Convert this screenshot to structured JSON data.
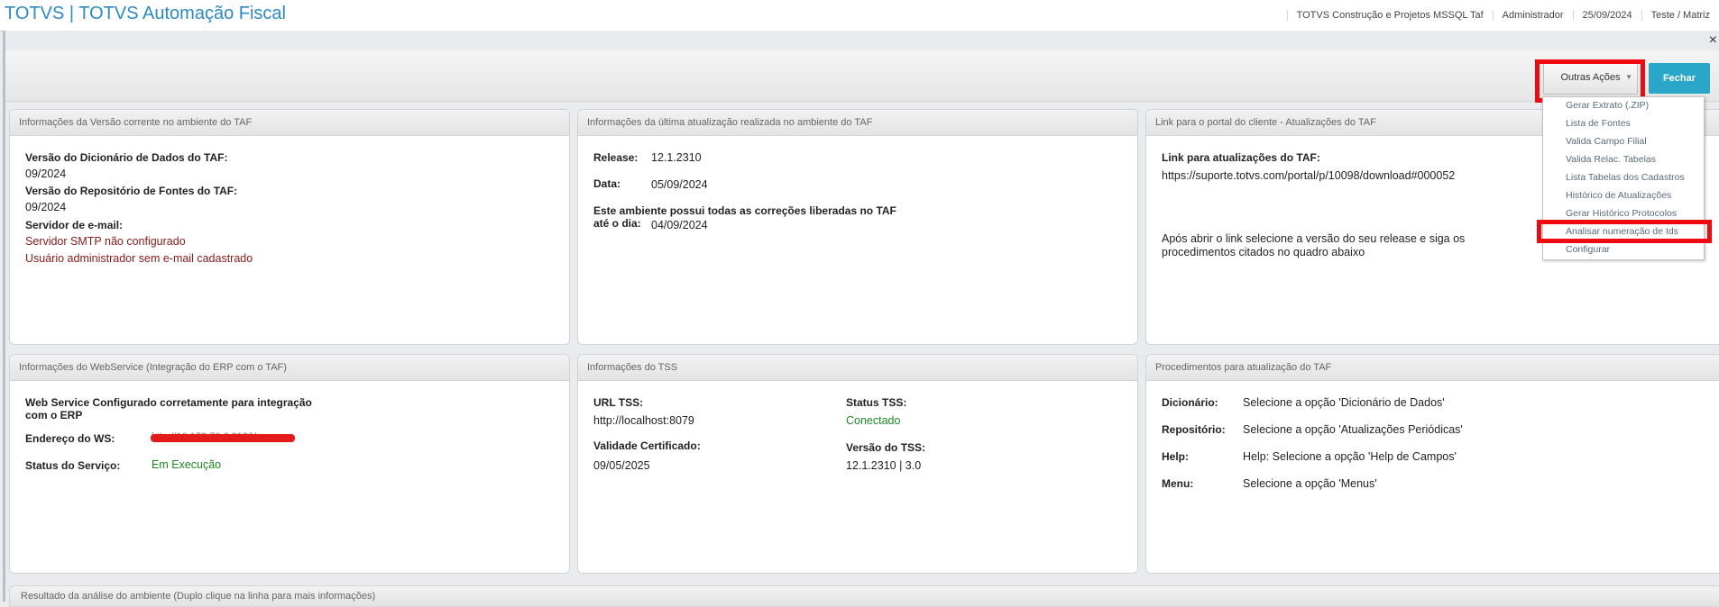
{
  "header": {
    "title": "TOTVS | TOTVS Automação Fiscal",
    "company": "TOTVS Construção e Projetos MSSQL Taf",
    "user": "Administrador",
    "date": "25/09/2024",
    "branch": "Teste / Matriz"
  },
  "toolbar": {
    "outras_acoes": "Outras Ações",
    "fechar": "Fechar",
    "close_symbol": "×"
  },
  "menu": {
    "items": [
      "Gerar Extrato (.ZIP)",
      "Lista de Fontes",
      "Valida Campo Filial",
      "Valida Relac. Tabelas",
      "Lista Tabelas dos Cadastros",
      "Histórico de Atualizações",
      "Gerar Histórico Protocolos",
      "Analisar numeração de Ids",
      "Configurar"
    ]
  },
  "panel_versao": {
    "title": "Informações da Versão corrente no ambiente do TAF",
    "dic_label": "Versão do Dicionário de Dados do TAF:",
    "dic_value": "09/2024",
    "rep_label": "Versão do Repositório de Fontes do TAF:",
    "rep_value": "09/2024",
    "email_label": "Servidor de e-mail:",
    "email_warn1": "Servidor SMTP não configurado",
    "email_warn2": "Usuário administrador sem e-mail cadastrado"
  },
  "panel_atualizacao": {
    "title": "Informações da última atualização realizada no ambiente do TAF",
    "release_label": "Release:",
    "release_value": "12.1.2310",
    "data_label": "Data:",
    "data_value": "05/09/2024",
    "corr_label1": "Este ambiente possui todas as correções liberadas no TAF",
    "corr_label2": "até o dia:",
    "corr_value": "04/09/2024"
  },
  "panel_link": {
    "title": "Link para o portal do cliente - Atualizações do TAF",
    "link_label": "Link para atualizações do TAF:",
    "link_value": "https://suporte.totvs.com/portal/p/10098/download#000052",
    "instr1": "Após abrir o link selecione a versão do seu release e siga os",
    "instr2": "procedimentos citados no quadro abaixo"
  },
  "panel_ws": {
    "title": "Informações do WebService (Integração do ERP com o TAF)",
    "status_text1": "Web Service Configurado corretamente para integração",
    "status_text2": "com o ERP",
    "endereco_label": "Endereço do WS:",
    "endereco_value": "http://10.173.70.6:8180/",
    "servico_label": "Status do Serviço:",
    "servico_value": "Em Execução"
  },
  "panel_tss": {
    "title": "Informações do TSS",
    "url_label": "URL TSS:",
    "url_value": "http://localhost:8079",
    "status_label": "Status TSS:",
    "status_value": "Conectado",
    "validade_label": "Validade Certificado:",
    "validade_value": "09/05/2025",
    "versao_label": "Versão do TSS:",
    "versao_value": "12.1.2310 | 3.0"
  },
  "panel_proc": {
    "title": "Procedimentos para atualização do TAF",
    "rows": [
      {
        "label": "Dicionário:",
        "value": "Selecione a opção 'Dicionário de Dados'"
      },
      {
        "label": "Repositório:",
        "value": "Selecione a opção 'Atualizações Periódicas'"
      },
      {
        "label": "Help:",
        "value": "Help: Selecione a opção 'Help de Campos'"
      },
      {
        "label": "Menu:",
        "value": "Selecione a opção 'Menus'"
      }
    ]
  },
  "bottom": {
    "title": "Resultado da análise do ambiente (Duplo clique na linha para mais informações)"
  },
  "colors": {
    "accent": "#2b89c5",
    "fechar": "#2aa6c9",
    "highlight": "#ee0a0f",
    "warning": "#8b1a1a",
    "ok": "#1a8a22"
  }
}
